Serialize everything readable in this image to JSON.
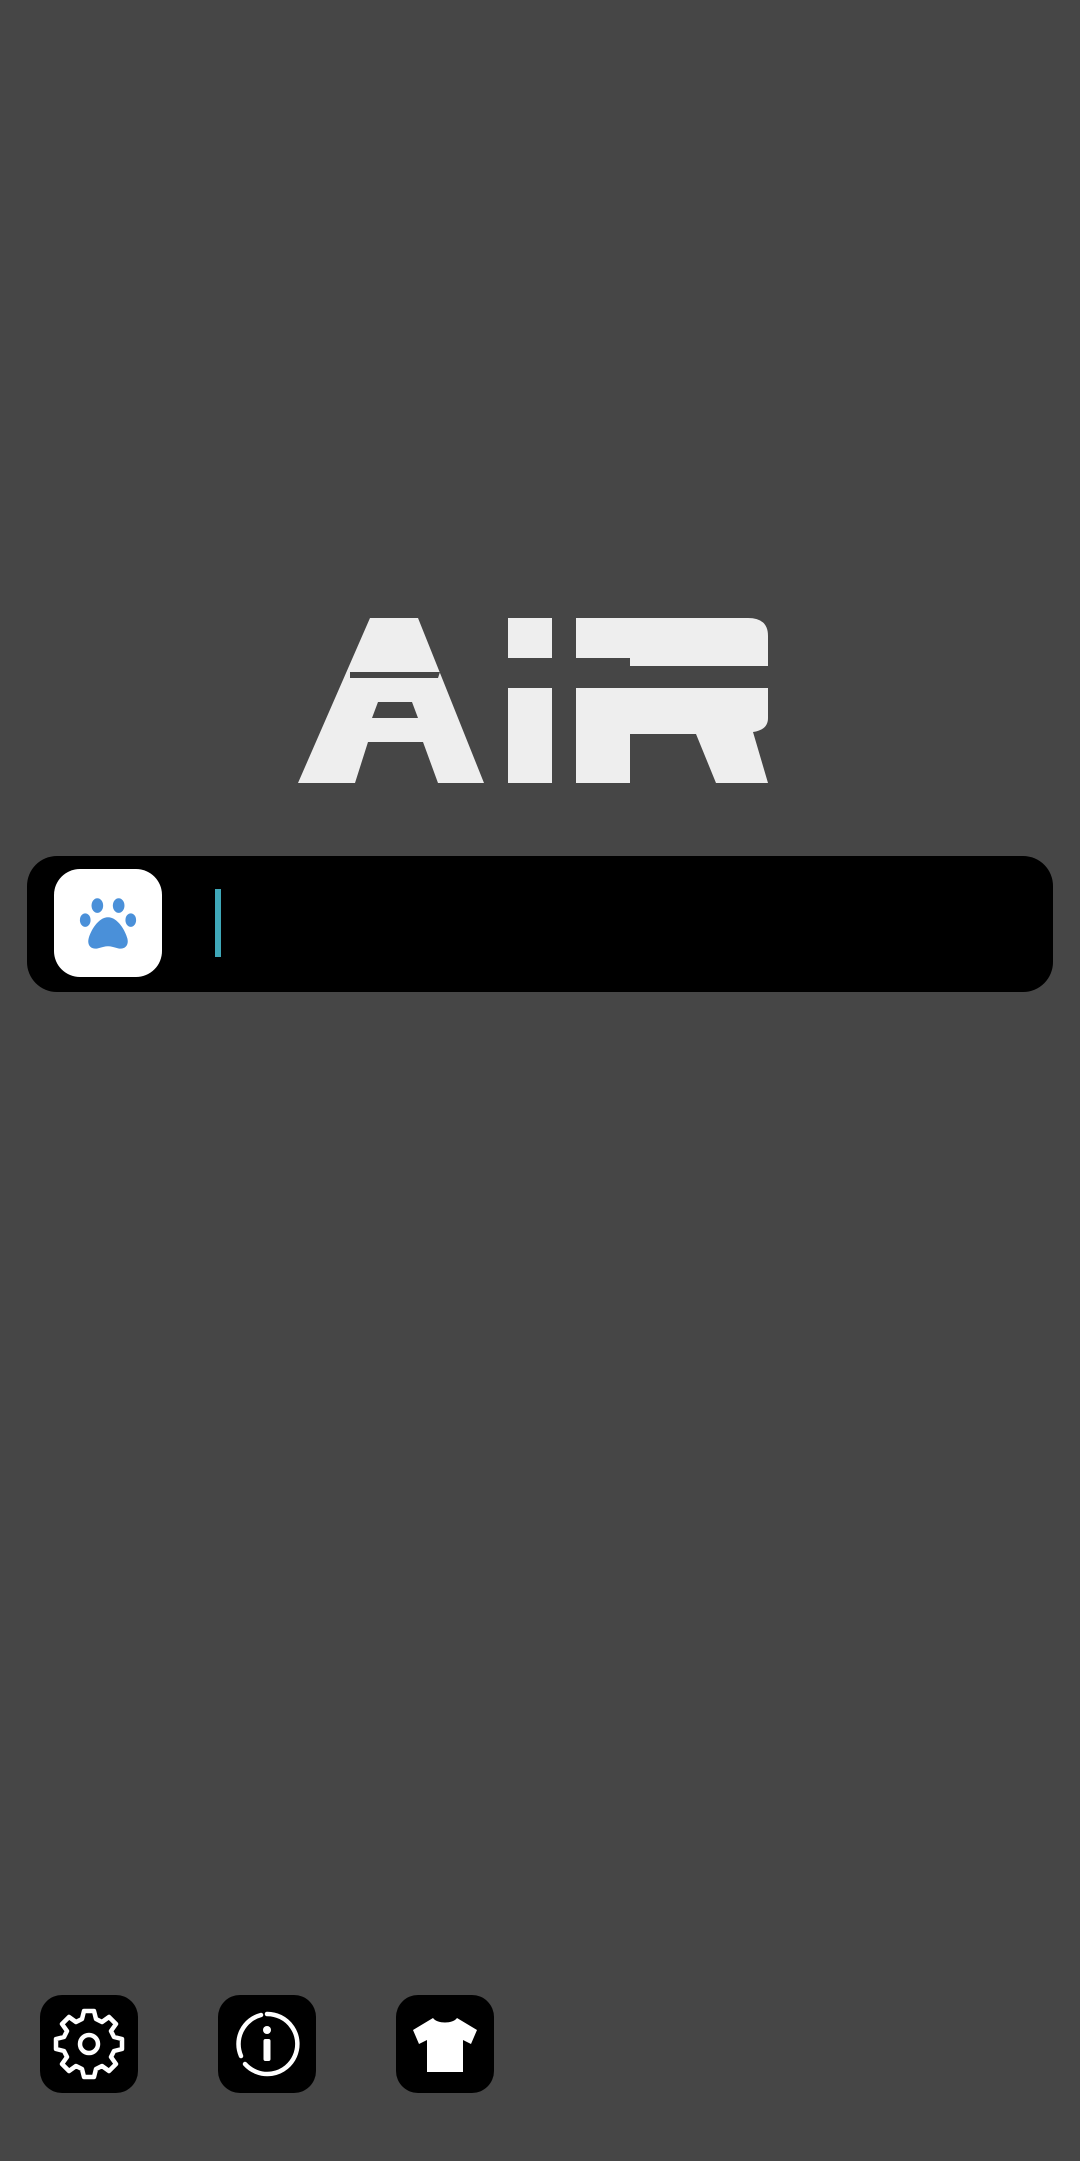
{
  "app": {
    "logo_text": "AiR"
  },
  "search": {
    "value": "",
    "placeholder": "",
    "engine_icon": "paw-icon"
  },
  "toolbar": {
    "buttons": [
      {
        "icon": "gear-icon",
        "purpose": "settings"
      },
      {
        "icon": "info-icon",
        "purpose": "info"
      },
      {
        "icon": "shirt-icon",
        "purpose": "theme"
      }
    ]
  },
  "colors": {
    "background": "#464646",
    "search_bar": "#000000",
    "logo": "#eeeeee",
    "caret": "#3fa7b8",
    "engine_icon": "#4a90d9"
  }
}
